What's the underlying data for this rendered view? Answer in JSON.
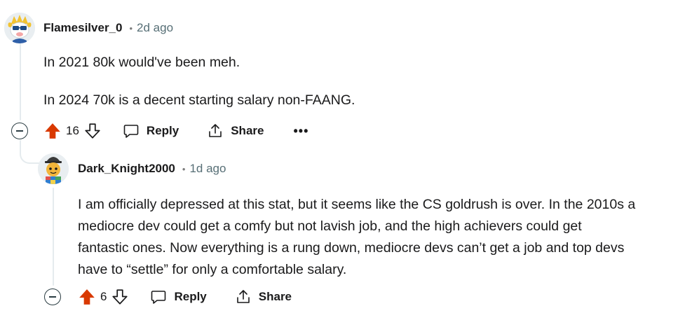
{
  "comments": [
    {
      "username": "Flamesilver_0",
      "age": "2d ago",
      "avatar": "avatar-flamesilver",
      "paragraphs": [
        "In 2021 80k would've been meh.",
        "In 2024 70k is a decent starting salary non-FAANG."
      ],
      "upvotes": "16",
      "upvote_state": "upvoted",
      "reply_label": "Reply",
      "share_label": "Share",
      "more_label": "•••"
    },
    {
      "username": "Dark_Knight2000",
      "age": "1d ago",
      "avatar": "avatar-dark-knight",
      "lines": [
        "I am officially depressed at this stat, but it seems like the CS goldrush is over. In the 2010s a",
        "mediocre dev could get a comfy but not lavish job, and the high achievers could get",
        "fantastic ones. Now everything is a rung down, mediocre devs can’t get a job and top devs",
        "have to “settle” for only a comfortable salary."
      ],
      "upvotes": "6",
      "upvote_state": "upvoted",
      "reply_label": "Reply",
      "share_label": "Share"
    }
  ],
  "meta": {
    "separator": "•"
  },
  "colors": {
    "upvote_active": "#d93900",
    "thread_line": "#e5ebee",
    "muted_text": "#576f76"
  },
  "icons": [
    "upvote-icon",
    "downvote-icon",
    "reply-icon",
    "share-icon",
    "collapse-icon",
    "more-icon"
  ]
}
